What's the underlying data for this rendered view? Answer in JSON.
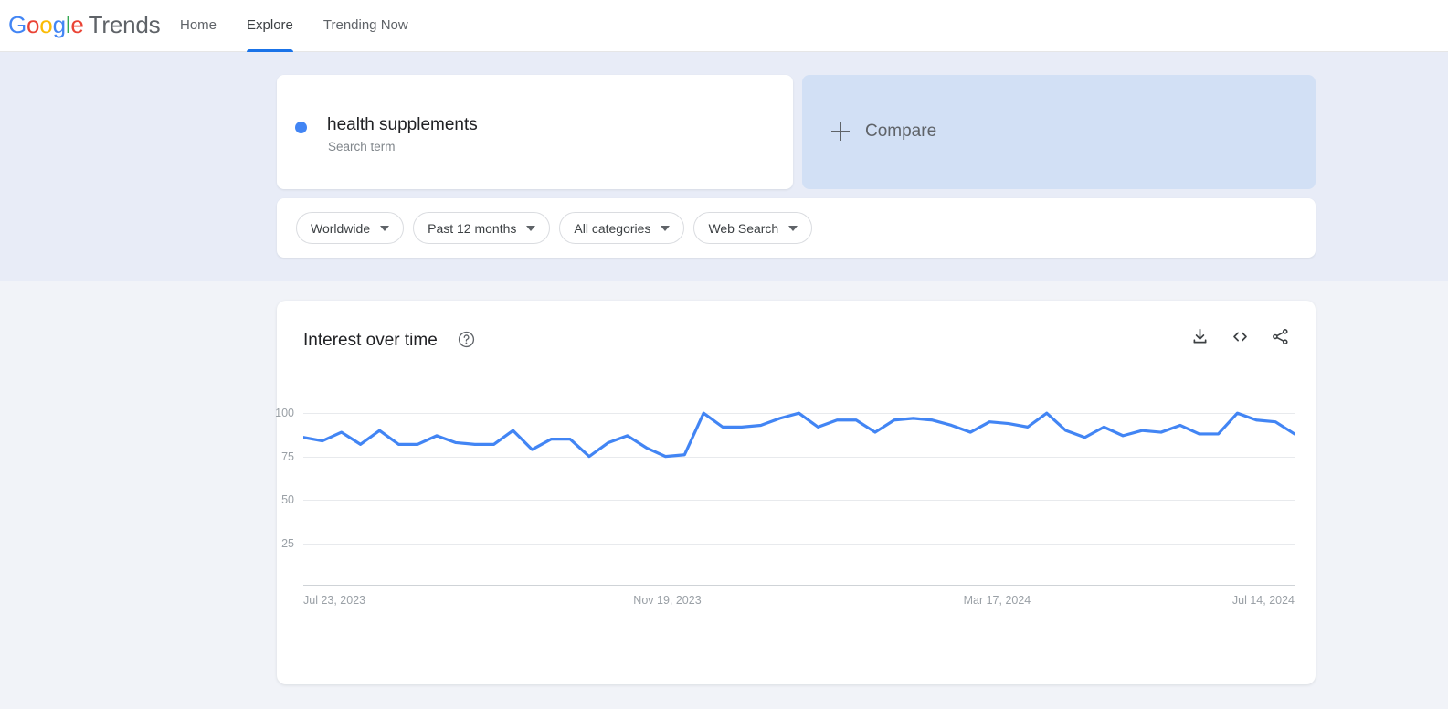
{
  "brand": {
    "g1": "G",
    "g2": "o",
    "g3": "o",
    "g4": "g",
    "g5": "l",
    "g6": "e",
    "product": "Trends"
  },
  "nav": {
    "items": [
      {
        "label": "Home",
        "active": false
      },
      {
        "label": "Explore",
        "active": true
      },
      {
        "label": "Trending Now",
        "active": false
      }
    ]
  },
  "query": {
    "term": {
      "name": "health supplements",
      "type": "Search term",
      "color": "#4285f4"
    },
    "compare": {
      "label": "Compare"
    }
  },
  "filters": [
    {
      "label": "Worldwide"
    },
    {
      "label": "Past 12 months"
    },
    {
      "label": "All categories"
    },
    {
      "label": "Web Search"
    }
  ],
  "chart_card": {
    "title": "Interest over time",
    "help_icon": "help-circle-icon",
    "actions": [
      {
        "name": "download-icon",
        "label": "Download CSV"
      },
      {
        "name": "embed-code-icon",
        "label": "Embed"
      },
      {
        "name": "share-icon",
        "label": "Share"
      }
    ]
  },
  "chart_data": {
    "type": "line",
    "title": "Interest over time",
    "xlabel": "",
    "ylabel": "",
    "ylim": [
      0,
      108
    ],
    "yticks": [
      100,
      75,
      50,
      25
    ],
    "xtick_labels": [
      "Jul 23, 2023",
      "Nov 19, 2023",
      "Mar 17, 2024",
      "Jul 14, 2024"
    ],
    "xtick_positions": [
      0,
      0.333,
      0.666,
      1.0
    ],
    "grid": true,
    "legend": false,
    "series": [
      {
        "name": "health supplements",
        "color": "#4285f4",
        "values": [
          86,
          84,
          89,
          82,
          90,
          82,
          82,
          87,
          83,
          82,
          82,
          90,
          79,
          85,
          85,
          75,
          83,
          87,
          80,
          75,
          76,
          100,
          92,
          92,
          93,
          97,
          100,
          92,
          96,
          96,
          89,
          96,
          97,
          96,
          93,
          89,
          95,
          94,
          92,
          100,
          90,
          86,
          92,
          87,
          90,
          89,
          93,
          88,
          88,
          100,
          96,
          95,
          88
        ]
      }
    ]
  }
}
